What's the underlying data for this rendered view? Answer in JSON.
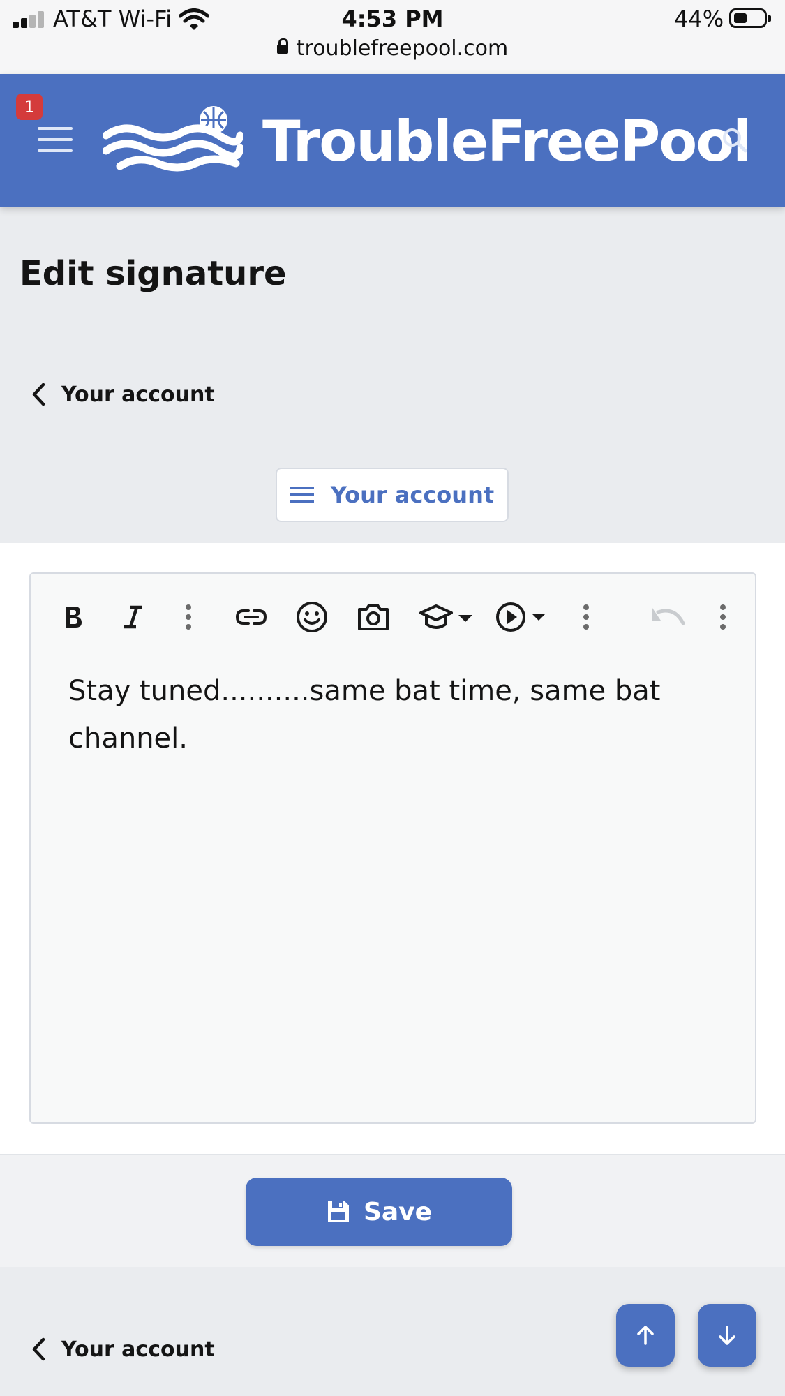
{
  "status_bar": {
    "carrier": "AT&T Wi-Fi",
    "time": "4:53 PM",
    "battery_percent": "44%",
    "battery_level": 0.44,
    "url": "troublefreepool.com"
  },
  "header": {
    "brand": "TroubleFreePool",
    "notification_count": "1"
  },
  "page": {
    "title": "Edit signature",
    "breadcrumb": "Your account",
    "account_menu_label": "Your account"
  },
  "editor": {
    "content": "Stay tuned..........same bat time,   same bat channel.",
    "toolbar": [
      "bold-icon",
      "italic-icon",
      "more-vertical-icon",
      "link-icon",
      "smiley-icon",
      "camera-icon",
      "graduation-cap-icon",
      "play-circle-icon",
      "more-vertical-icon",
      "undo-icon",
      "more-vertical-icon"
    ]
  },
  "actions": {
    "save_label": "Save"
  },
  "footer": {
    "breadcrumb": "Your account"
  },
  "colors": {
    "brand_blue": "#4b70c0",
    "badge_red": "#d43b3b",
    "page_bg": "#eaecef"
  }
}
